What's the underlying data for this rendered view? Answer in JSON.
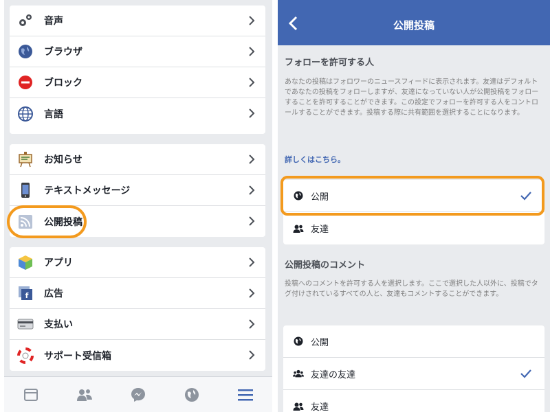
{
  "left": {
    "group1": [
      {
        "label": "音声",
        "icon": "sound-gear-icon"
      },
      {
        "label": "ブラウザ",
        "icon": "browser-globe-icon"
      },
      {
        "label": "ブロック",
        "icon": "block-icon"
      },
      {
        "label": "言語",
        "icon": "language-globe-icon"
      }
    ],
    "group2": [
      {
        "label": "お知らせ",
        "icon": "notification-board-icon"
      },
      {
        "label": "テキストメッセージ",
        "icon": "phone-message-icon"
      },
      {
        "label": "公開投稿",
        "icon": "rss-feed-icon"
      }
    ],
    "group3": [
      {
        "label": "アプリ",
        "icon": "app-cube-icon"
      },
      {
        "label": "広告",
        "icon": "ads-icon"
      },
      {
        "label": "支払い",
        "icon": "credit-card-icon"
      },
      {
        "label": "サポート受信箱",
        "icon": "lifebuoy-icon"
      }
    ],
    "tabbar": [
      "news-feed-icon",
      "friends-icon",
      "messenger-icon",
      "globe-icon",
      "menu-icon"
    ],
    "highlight_color": "#f39a1e"
  },
  "right": {
    "nav_title": "公開投稿",
    "nav_color": "#4267b2",
    "section1_title": "フォローを許可する人",
    "section1_desc": "あなたの投稿はフォロワーのニュースフィードに表示されます。友達はデフォルトであなたの投稿をフォローしますが、友達になっていない人が公開投稿をフォローすることを許可することができます。この設定でフォローを許可する人をコントロールすることができます。投稿する際に共有範囲を選択することになります。",
    "section1_link": "詳しくはこちら。",
    "section1_options": [
      {
        "label": "公開",
        "icon": "globe-icon",
        "selected": true
      },
      {
        "label": "友達",
        "icon": "friends-icon",
        "selected": false
      }
    ],
    "section2_title": "公開投稿のコメント",
    "section2_desc": "投稿へのコメントを許可する人を選択します。ここで選択した人以外に、投稿でタグ付けされているすべての人と、友達もコメントすることができます。",
    "section2_options": [
      {
        "label": "公開",
        "icon": "globe-icon",
        "selected": false
      },
      {
        "label": "友達の友達",
        "icon": "friends-of-friends-icon",
        "selected": true
      },
      {
        "label": "友達",
        "icon": "friends-icon",
        "selected": false
      }
    ]
  }
}
